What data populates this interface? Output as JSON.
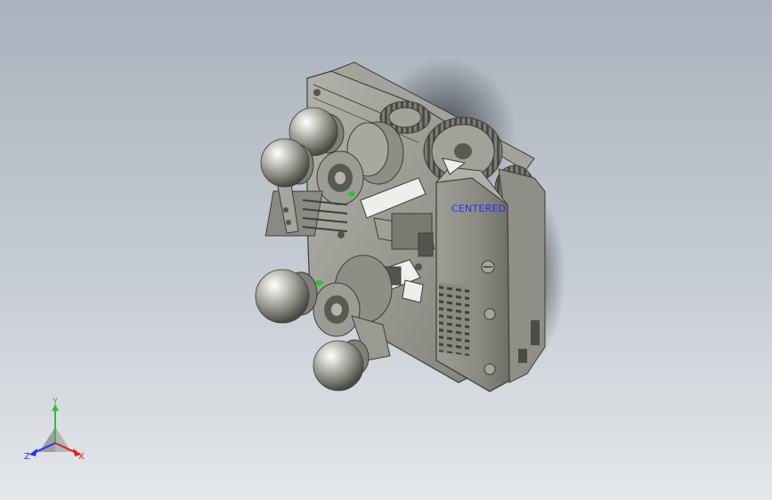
{
  "viewport": {
    "background_top": "#a9b2bd",
    "background_bottom": "#e4e7eb"
  },
  "model": {
    "annotation": "CENTERED",
    "part_color": "#9a9a92",
    "dark_color": "#3e3e3a",
    "highlight_color": "#2fbf3a"
  },
  "triad": {
    "y_label": "Y",
    "x_label": "X",
    "z_label": "Z",
    "y_color": "#2fbf3a",
    "x_color": "#e02020",
    "z_color": "#2a35d8"
  }
}
